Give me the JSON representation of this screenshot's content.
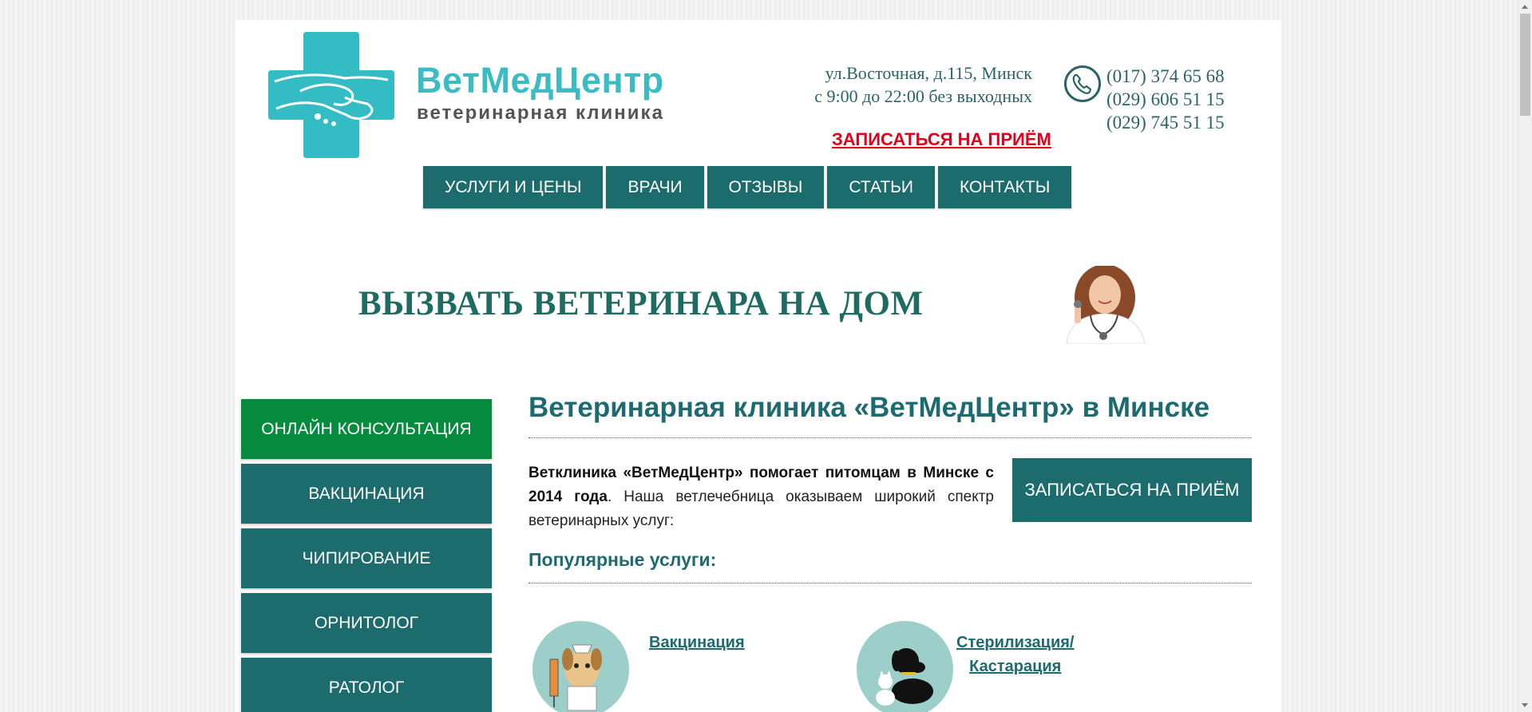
{
  "header": {
    "logo_name": "ВетМедЦентр",
    "logo_subtitle": "ветеринарная клиника",
    "address": "ул.Восточная, д.115, Минск",
    "hours": "с 9:00 до 22:00 без выходных",
    "phones": [
      "(017) 374 65 68",
      "(029) 606 51 15",
      "(029) 745 51 15"
    ],
    "book_link": "ЗАПИСАТЬСЯ НА ПРИЁМ",
    "book_color": "#e2001a"
  },
  "nav": {
    "items": [
      "УСЛУГИ И ЦЕНЫ",
      "ВРАЧИ",
      "ОТЗЫВЫ",
      "СТАТЬИ",
      "КОНТАКТЫ"
    ]
  },
  "banner": {
    "text": "ВЫЗВАТЬ ВЕТЕРИНАРА НА ДОМ"
  },
  "sidebar": {
    "items": [
      "ОНЛАЙН КОНСУЛЬТАЦИЯ",
      "ВАКЦИНАЦИЯ",
      "ЧИПИРОВАНИЕ",
      "ОРНИТОЛОГ",
      "РАТОЛОГ"
    ]
  },
  "main": {
    "title": "Ветеринарная клиника «ВетМедЦентр» в Минске",
    "intro_bold": "Ветклиника «ВетМедЦентр» помогает питомцам в Минске с 2014 года",
    "intro_rest": ". Наша ветлечебница оказываем широкий спектр ветеринарных услуг:",
    "book_button": "ЗАПИСАТЬСЯ НА ПРИЁМ",
    "popular_title": "Популярные услуги:",
    "services": [
      {
        "line1": "Вакцинация",
        "line2": "",
        "icon": "vaccination-dog-icon"
      },
      {
        "line1": "Стерилизация/",
        "line2": "Кастарация",
        "icon": "cat-dog-icon"
      }
    ]
  },
  "colors": {
    "brand_teal": "#1c6b6d",
    "logo_teal": "#3bbcc4",
    "consult_green": "#068b3e"
  }
}
